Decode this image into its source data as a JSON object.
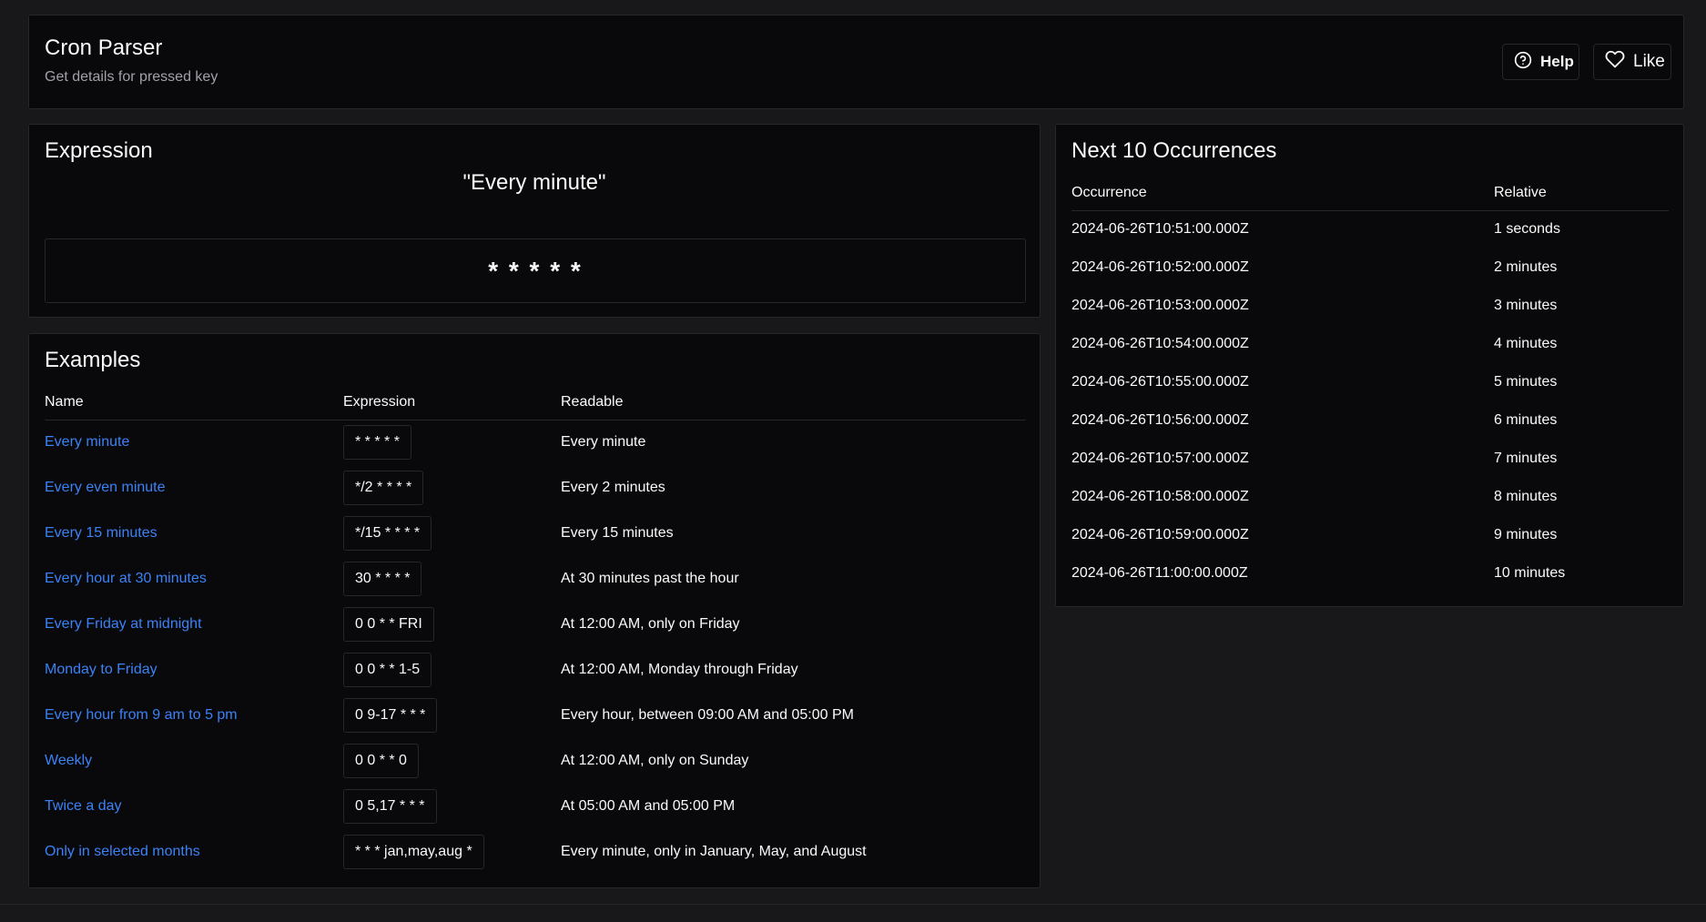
{
  "header": {
    "title": "Cron Parser",
    "subtitle": "Get details for pressed key",
    "help_label": "Help",
    "like_label": "Like"
  },
  "expression": {
    "title": "Expression",
    "readable": "\"Every minute\"",
    "value": "* * * * *"
  },
  "examples": {
    "title": "Examples",
    "columns": [
      "Name",
      "Expression",
      "Readable"
    ],
    "rows": [
      {
        "name": "Every minute",
        "expression": "* * * * *",
        "readable": "Every minute"
      },
      {
        "name": "Every even minute",
        "expression": "*/2 * * * *",
        "readable": "Every 2 minutes"
      },
      {
        "name": "Every 15 minutes",
        "expression": "*/15 * * * *",
        "readable": "Every 15 minutes"
      },
      {
        "name": "Every hour at 30 minutes",
        "expression": "30 * * * *",
        "readable": "At 30 minutes past the hour"
      },
      {
        "name": "Every Friday at midnight",
        "expression": "0 0 * * FRI",
        "readable": "At 12:00 AM, only on Friday"
      },
      {
        "name": "Monday to Friday",
        "expression": "0 0 * * 1-5",
        "readable": "At 12:00 AM, Monday through Friday"
      },
      {
        "name": "Every hour from 9 am to 5 pm",
        "expression": "0 9-17 * * *",
        "readable": "Every hour, between 09:00 AM and 05:00 PM"
      },
      {
        "name": "Weekly",
        "expression": "0 0 * * 0",
        "readable": "At 12:00 AM, only on Sunday"
      },
      {
        "name": "Twice a day",
        "expression": "0 5,17 * * *",
        "readable": "At 05:00 AM and 05:00 PM"
      },
      {
        "name": "Only in selected months",
        "expression": "* * * jan,may,aug *",
        "readable": "Every minute, only in January, May, and August"
      }
    ]
  },
  "occurrences": {
    "title": "Next 10 Occurrences",
    "columns": [
      "Occurrence",
      "Relative"
    ],
    "rows": [
      {
        "occurrence": "2024-06-26T10:51:00.000Z",
        "relative": "1 seconds"
      },
      {
        "occurrence": "2024-06-26T10:52:00.000Z",
        "relative": "2 minutes"
      },
      {
        "occurrence": "2024-06-26T10:53:00.000Z",
        "relative": "3 minutes"
      },
      {
        "occurrence": "2024-06-26T10:54:00.000Z",
        "relative": "4 minutes"
      },
      {
        "occurrence": "2024-06-26T10:55:00.000Z",
        "relative": "5 minutes"
      },
      {
        "occurrence": "2024-06-26T10:56:00.000Z",
        "relative": "6 minutes"
      },
      {
        "occurrence": "2024-06-26T10:57:00.000Z",
        "relative": "7 minutes"
      },
      {
        "occurrence": "2024-06-26T10:58:00.000Z",
        "relative": "8 minutes"
      },
      {
        "occurrence": "2024-06-26T10:59:00.000Z",
        "relative": "9 minutes"
      },
      {
        "occurrence": "2024-06-26T11:00:00.000Z",
        "relative": "10 minutes"
      }
    ]
  },
  "icons": {
    "help": "help-circle-icon",
    "like": "heart-icon"
  },
  "colors": {
    "background": "#18181b",
    "panel": "#09090b",
    "border": "#27272a",
    "link": "#3b82f6",
    "muted": "#a1a1aa"
  }
}
